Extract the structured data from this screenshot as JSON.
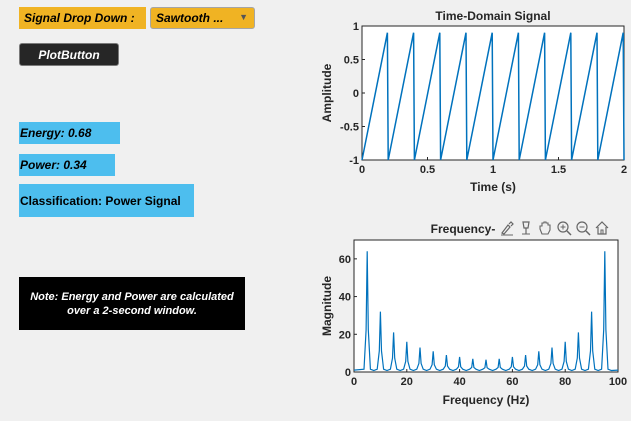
{
  "controls": {
    "signal_label": "Signal Drop Down :",
    "dropdown_value": "Sawtooth ...",
    "plot_button": "PlotButton",
    "energy": "Energy: 0.68",
    "power": "Power: 0.34",
    "classification": "Classification: Power Signal",
    "note": "Note: Energy and Power are calculated over a 2-second window."
  },
  "toolbar": {
    "icons": [
      "brush-icon",
      "data-tips-icon",
      "pan-icon",
      "zoom-in-icon",
      "zoom-out-icon",
      "home-icon"
    ]
  },
  "colors": {
    "accent_orange": "#f0b323",
    "label_blue": "#4dbeee",
    "line_blue": "#0072bd",
    "button_dark": "#262626"
  },
  "chart_data": [
    {
      "type": "line",
      "title": "Time-Domain Signal",
      "xlabel": "Time (s)",
      "ylabel": "Amplitude",
      "xlim": [
        0,
        2
      ],
      "ylim": [
        -1,
        1
      ],
      "xticks": [
        "0",
        "0.5",
        "1",
        "1.5",
        "2"
      ],
      "yticks": [
        "-1",
        "-0.5",
        "0",
        "0.5",
        "1"
      ],
      "waveform": "sawtooth",
      "frequency_hz": 5,
      "amplitude_min": -1,
      "amplitude_max": 0.9,
      "grid": false
    },
    {
      "type": "line",
      "title": "Frequency-",
      "xlabel": "Frequency (Hz)",
      "ylabel": "Magnitude",
      "xlim": [
        0,
        100
      ],
      "ylim": [
        0,
        70
      ],
      "xticks": [
        "0",
        "20",
        "40",
        "60",
        "80",
        "100"
      ],
      "yticks": [
        "0",
        "20",
        "40",
        "60"
      ],
      "peaks": {
        "x": [
          5,
          10,
          15,
          20,
          25,
          30,
          35,
          40,
          45,
          50,
          55,
          60,
          65,
          70,
          75,
          80,
          85,
          90,
          95
        ],
        "y": [
          64,
          32,
          21,
          16,
          13,
          11,
          9,
          8,
          7,
          6.5,
          7,
          8,
          9,
          11,
          13,
          16,
          21,
          32,
          64
        ]
      },
      "grid": false
    }
  ]
}
